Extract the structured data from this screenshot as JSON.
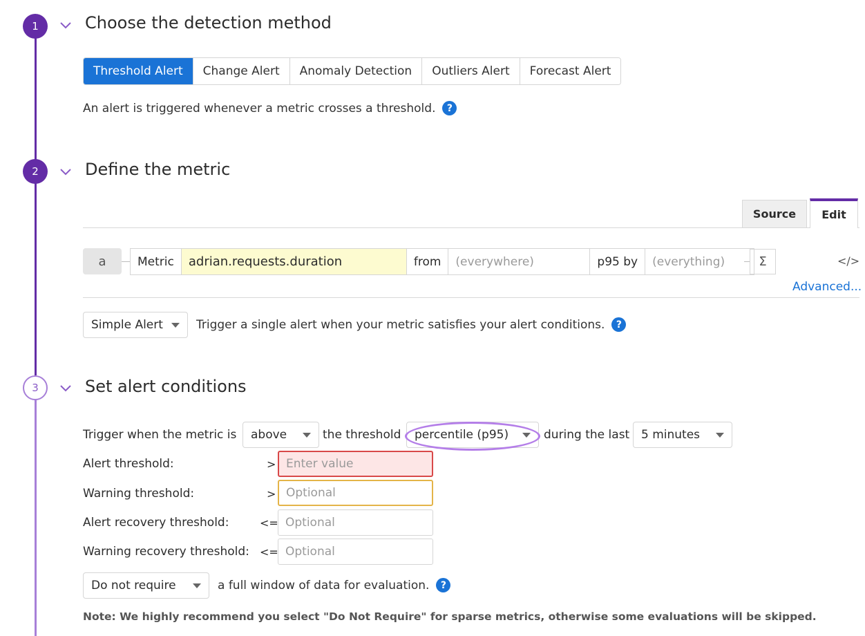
{
  "steps": [
    {
      "number": "1",
      "title": "Choose the detection method"
    },
    {
      "number": "2",
      "title": "Define the metric"
    },
    {
      "number": "3",
      "title": "Set alert conditions"
    }
  ],
  "detection": {
    "tabs": [
      "Threshold Alert",
      "Change Alert",
      "Anomaly Detection",
      "Outliers Alert",
      "Forecast Alert"
    ],
    "active_tab": "Threshold Alert",
    "description": "An alert is triggered whenever a metric crosses a threshold."
  },
  "metric": {
    "tabs": [
      "Source",
      "Edit"
    ],
    "active_tab": "Edit",
    "query_letter": "a",
    "metric_label": "Metric",
    "metric_name": "adrian.requests.duration",
    "from_label": "from",
    "from_placeholder": "(everywhere)",
    "agg_label": "p95 by",
    "by_placeholder": "(everything)",
    "sigma": "Σ",
    "code_icon": "</>",
    "advanced_link": "Advanced...",
    "alert_type": "Simple Alert",
    "alert_type_desc": "Trigger a single alert when your metric satisfies your alert conditions."
  },
  "conditions": {
    "trigger_prefix": "Trigger when the metric is",
    "comparison": "above",
    "threshold_label": "the threshold",
    "aggregation": "percentile (p95)",
    "during_label": "during the last",
    "window": "5 minutes",
    "rows": [
      {
        "label": "Alert threshold:",
        "operator": ">",
        "placeholder": "Enter value"
      },
      {
        "label": "Warning threshold:",
        "operator": ">",
        "placeholder": "Optional"
      },
      {
        "label": "Alert recovery threshold:",
        "operator": "<=",
        "placeholder": "Optional"
      },
      {
        "label": "Warning recovery threshold:",
        "operator": "<=",
        "placeholder": "Optional"
      }
    ],
    "require_window": "Do not require",
    "require_window_desc": "a full window of data for evaluation.",
    "note": "Note: We highly recommend you select \"Do Not Require\" for sparse metrics, otherwise some evaluations will be skipped."
  },
  "icons": {
    "help": "question-circle-icon",
    "chevron": "chevron-down-icon"
  },
  "colors": {
    "primary": "#632ca6",
    "accent": "#1a73d6",
    "alert_border": "#d84848",
    "warning_border": "#e4b448",
    "highlight": "#b47ee8"
  }
}
